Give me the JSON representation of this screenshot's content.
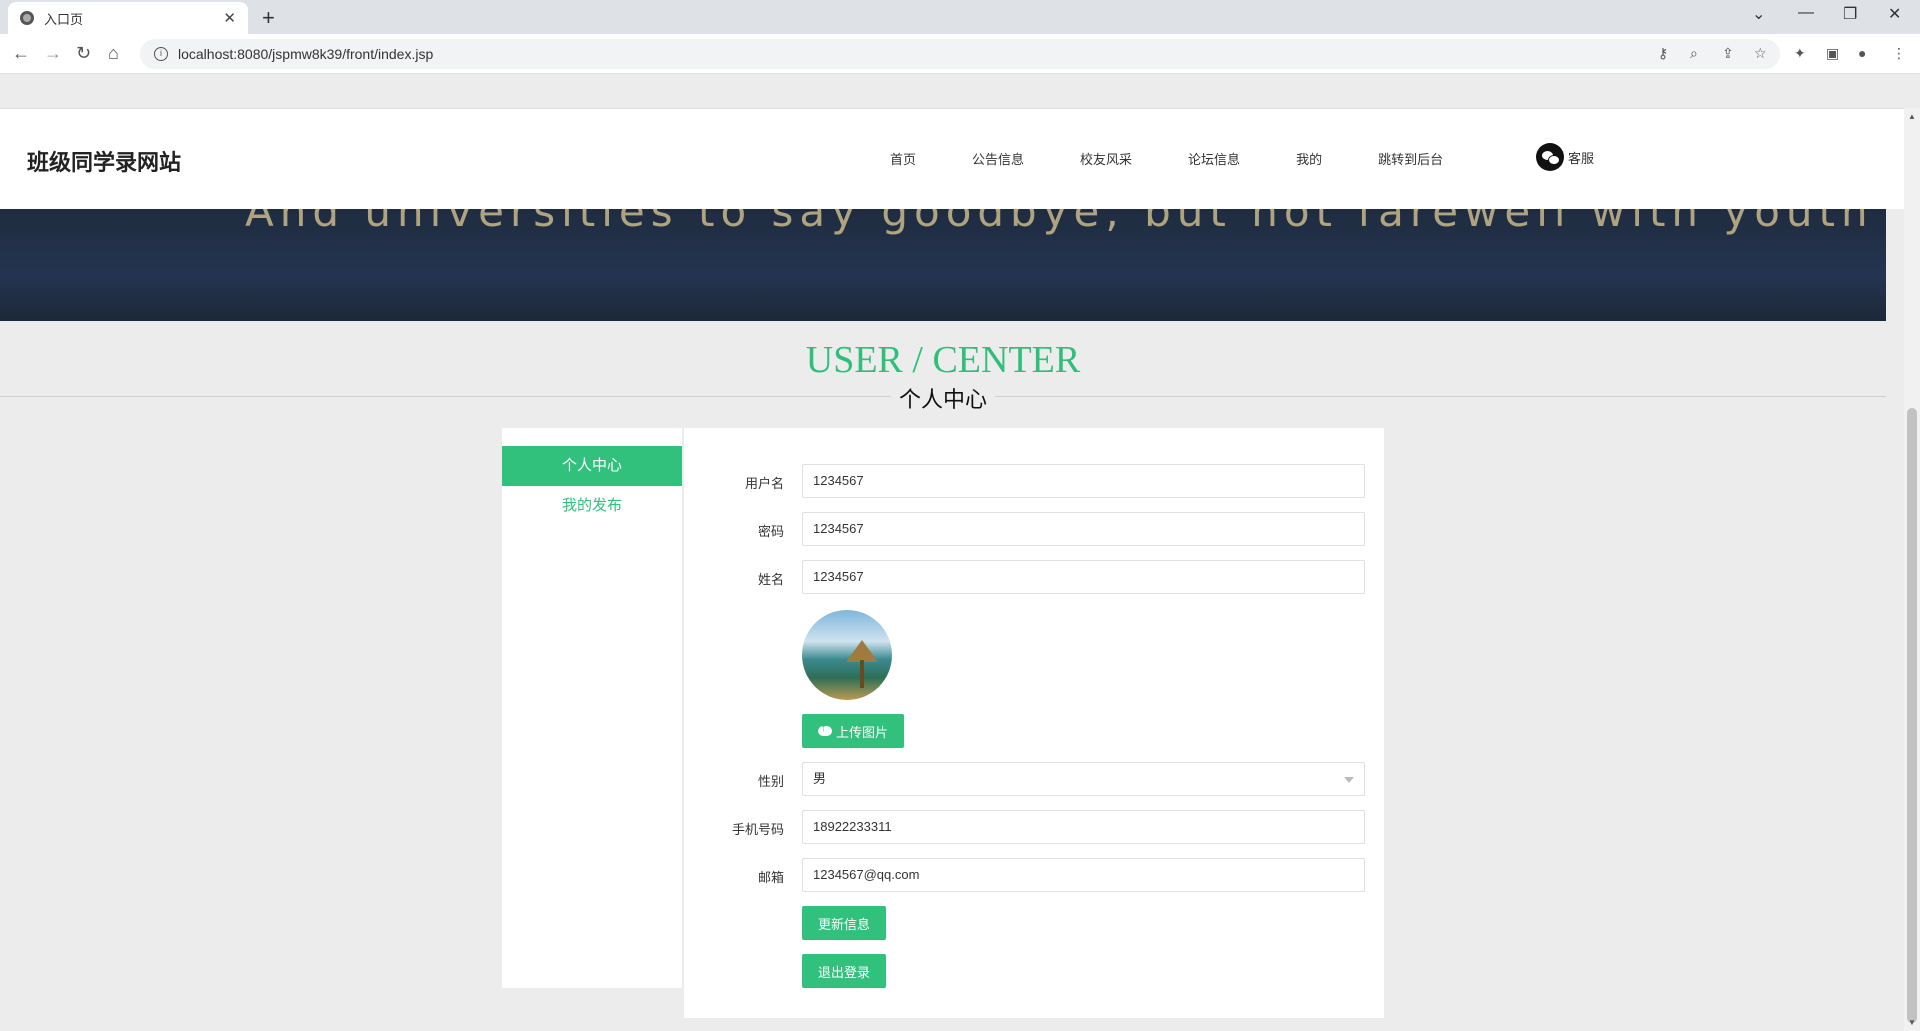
{
  "browser": {
    "tab_title": "入口页",
    "tab_close": "✕",
    "new_tab": "+",
    "url": "localhost:8080/jspmw8k39/front/index.jsp"
  },
  "site": {
    "title": "班级同学录网站",
    "menu": [
      "首页",
      "公告信息",
      "校友风采",
      "论坛信息",
      "我的",
      "跳转到后台"
    ],
    "kefu": "客服"
  },
  "banner": {
    "text": "And universities to say goodbye, but not farewell with youth"
  },
  "center": {
    "title": "USER / CENTER",
    "subtitle": "个人中心"
  },
  "sidebar": {
    "items": [
      {
        "label": "个人中心",
        "active": true
      },
      {
        "label": "我的发布",
        "active": false
      }
    ]
  },
  "form": {
    "username_label": "用户名",
    "username_value": "1234567",
    "password_label": "密码",
    "password_value": "1234567",
    "name_label": "姓名",
    "name_value": "1234567",
    "upload_label": "上传图片",
    "gender_label": "性别",
    "gender_value": "男",
    "phone_label": "手机号码",
    "phone_value": "18922233311",
    "email_label": "邮箱",
    "email_value": "1234567@qq.com",
    "update_button": "更新信息",
    "logout_button": "退出登录"
  },
  "colors": {
    "accent": "#32c17d",
    "title_green": "#2fbf7a",
    "banner_bg": "#1f2c40"
  }
}
